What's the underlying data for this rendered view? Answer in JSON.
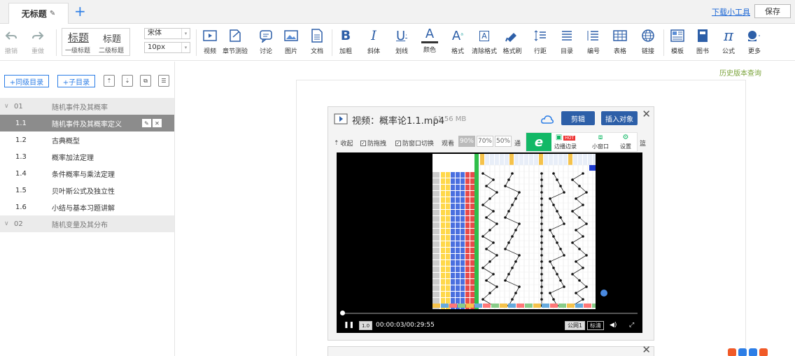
{
  "tabs": {
    "active": "无标题",
    "download": "下载小工具",
    "save": "保存"
  },
  "toolbar": {
    "undo": "撤销",
    "redo": "重做",
    "heading1": "标题",
    "heading2": "标题",
    "heading1_sub": "一级标题",
    "heading2_sub": "二级标题",
    "font_family": "宋体",
    "font_size": "10px",
    "items": [
      "视频",
      "章节测验",
      "讨论",
      "图片",
      "文档",
      "加粗",
      "斜体",
      "划线",
      "颜色",
      "格式",
      "清除格式",
      "格式刷",
      "行距",
      "目录",
      "编号",
      "表格",
      "链接",
      "模板",
      "图书",
      "公式",
      "更多"
    ]
  },
  "sidebar": {
    "btn_add_dir": "+同级目录",
    "btn_add_sub": "+子目录",
    "items": [
      {
        "num": "01",
        "title": "随机事件及其概率",
        "chapter": true
      },
      {
        "num": "1.1",
        "title": "随机事件及其概率定义",
        "selected": true
      },
      {
        "num": "1.2",
        "title": "古典概型"
      },
      {
        "num": "1.3",
        "title": "概率加法定理"
      },
      {
        "num": "1.4",
        "title": "条件概率与乘法定理"
      },
      {
        "num": "1.5",
        "title": "贝叶斯公式及独立性"
      },
      {
        "num": "1.6",
        "title": "小结与基本习题讲解"
      },
      {
        "num": "02",
        "title": "随机变量及其分布",
        "chapter": true
      }
    ]
  },
  "history_link": "历史版本查询",
  "video_card": {
    "title": "视频：概率论1.1.mp4",
    "size": "61.56 MB",
    "edit": "剪辑",
    "insert": "插入对象",
    "options": {
      "collapse": "收起",
      "anti_drag": "防拖拽",
      "anti_switch": "防窗口切换",
      "watch": "观看",
      "pct": [
        "90%",
        "70%",
        "50%"
      ],
      "trail": "通",
      "cut": "篮"
    },
    "ext": {
      "record": "边播边录",
      "hot": "HOT",
      "mini": "小窗口",
      "settings": "设置"
    },
    "player": {
      "time": "00:00:03/00:29:55",
      "line": "公网1",
      "quality": "标清",
      "speed": "1.0",
      "progress": 0.005
    }
  },
  "colors": {
    "accent": "#2d7ee6",
    "card_button": "#2d5fa8",
    "ext_green": "#12b866"
  }
}
